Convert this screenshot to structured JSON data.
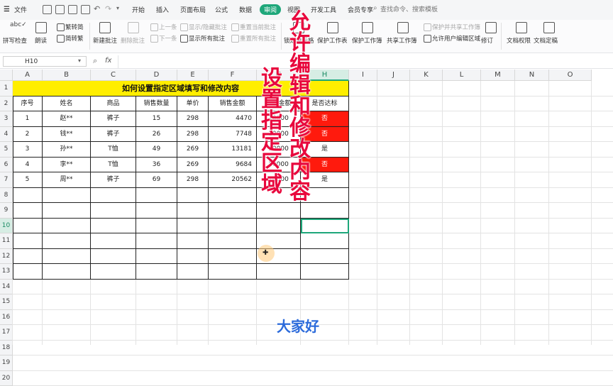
{
  "menu": {
    "file": "文件",
    "tabs": [
      "开始",
      "插入",
      "页面布局",
      "公式",
      "数据",
      "审阅",
      "视图",
      "开发工具",
      "会员专享"
    ],
    "active_tab": "审阅",
    "search_placeholder": "查找命令、搜索模板"
  },
  "ribbon": {
    "spell_check": "拼写检查",
    "read": "朗读",
    "trad_simp_1": "繁转简",
    "trad_simp_2": "简转繁",
    "new_comment": "新建批注",
    "delete_comment": "删除批注",
    "prev": "上一条",
    "next": "下一条",
    "show_hide_comment": "显示/隐藏批注",
    "show_all_comments": "显示所有批注",
    "reset_current_comment": "重置当前批注",
    "reset_all_comments": "重置所有批注",
    "lock_cell": "锁定单元格",
    "protect_sheet": "保护工作表",
    "protect_workbook": "保护工作簿",
    "share_workbook": "共享工作簿",
    "protect_share_workbook": "保护并共享工作簿",
    "allow_edit_ranges": "允许用户编辑区域",
    "revise": "修订",
    "doc_rights": "文档权限",
    "doc_finalize": "文档定稿"
  },
  "formula_bar": {
    "cell_ref": "H10",
    "fx": "fx"
  },
  "columns": [
    "A",
    "B",
    "C",
    "D",
    "E",
    "F",
    "G",
    "H",
    "I",
    "J",
    "K",
    "L",
    "M",
    "N",
    "O"
  ],
  "rows": [
    "1",
    "2",
    "3",
    "4",
    "5",
    "6",
    "7",
    "8",
    "9",
    "10",
    "11",
    "12",
    "13",
    "14",
    "15",
    "16",
    "17",
    "18",
    "19",
    "20"
  ],
  "selected_cell": "H10",
  "table": {
    "title": "如何设置指定区域填写和修改内容",
    "headers": [
      "序号",
      "姓名",
      "商品",
      "销售数量",
      "单价",
      "销售金额",
      "考核金额",
      "是否达标"
    ],
    "rows": [
      [
        "1",
        "赵**",
        "裤子",
        "15",
        "298",
        "4470",
        "10000",
        "否"
      ],
      [
        "2",
        "钱**",
        "裤子",
        "26",
        "298",
        "7748",
        "10000",
        "否"
      ],
      [
        "3",
        "孙**",
        "T恤",
        "49",
        "269",
        "13181",
        "10000",
        "是"
      ],
      [
        "4",
        "李**",
        "T恤",
        "36",
        "269",
        "9684",
        "10000",
        "否"
      ],
      [
        "5",
        "周**",
        "裤子",
        "69",
        "298",
        "20562",
        "10000",
        "是"
      ]
    ],
    "highlight_color": "#ff1a0d",
    "title_fill": "#ffee00"
  },
  "overlay": {
    "vertical_left": "设置指定区域",
    "vertical_right": "允许编辑和修改内容",
    "caption": "大家好",
    "overlay_color": "#e8083d",
    "caption_color": "#2c6bdb"
  },
  "accent_color": "#1ea77a"
}
